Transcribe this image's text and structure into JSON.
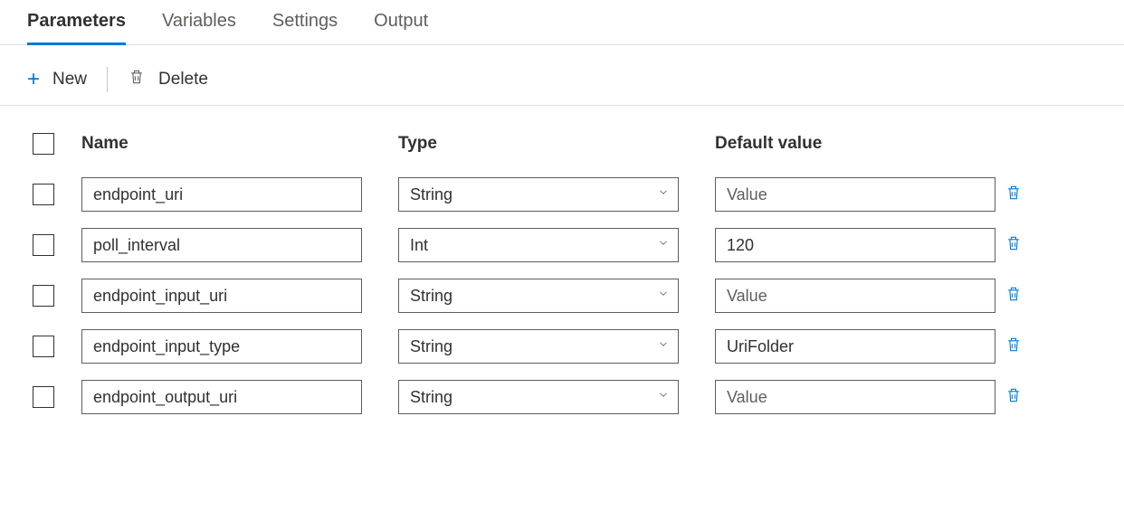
{
  "tabs": {
    "items": [
      "Parameters",
      "Variables",
      "Settings",
      "Output"
    ],
    "active": 0
  },
  "toolbar": {
    "new_label": "New",
    "delete_label": "Delete"
  },
  "columns": {
    "name": "Name",
    "type": "Type",
    "default": "Default value"
  },
  "value_placeholder": "Value",
  "rows": [
    {
      "name": "endpoint_uri",
      "type": "String",
      "default": ""
    },
    {
      "name": "poll_interval",
      "type": "Int",
      "default": "120"
    },
    {
      "name": "endpoint_input_uri",
      "type": "String",
      "default": ""
    },
    {
      "name": "endpoint_input_type",
      "type": "String",
      "default": "UriFolder"
    },
    {
      "name": "endpoint_output_uri",
      "type": "String",
      "default": ""
    }
  ]
}
